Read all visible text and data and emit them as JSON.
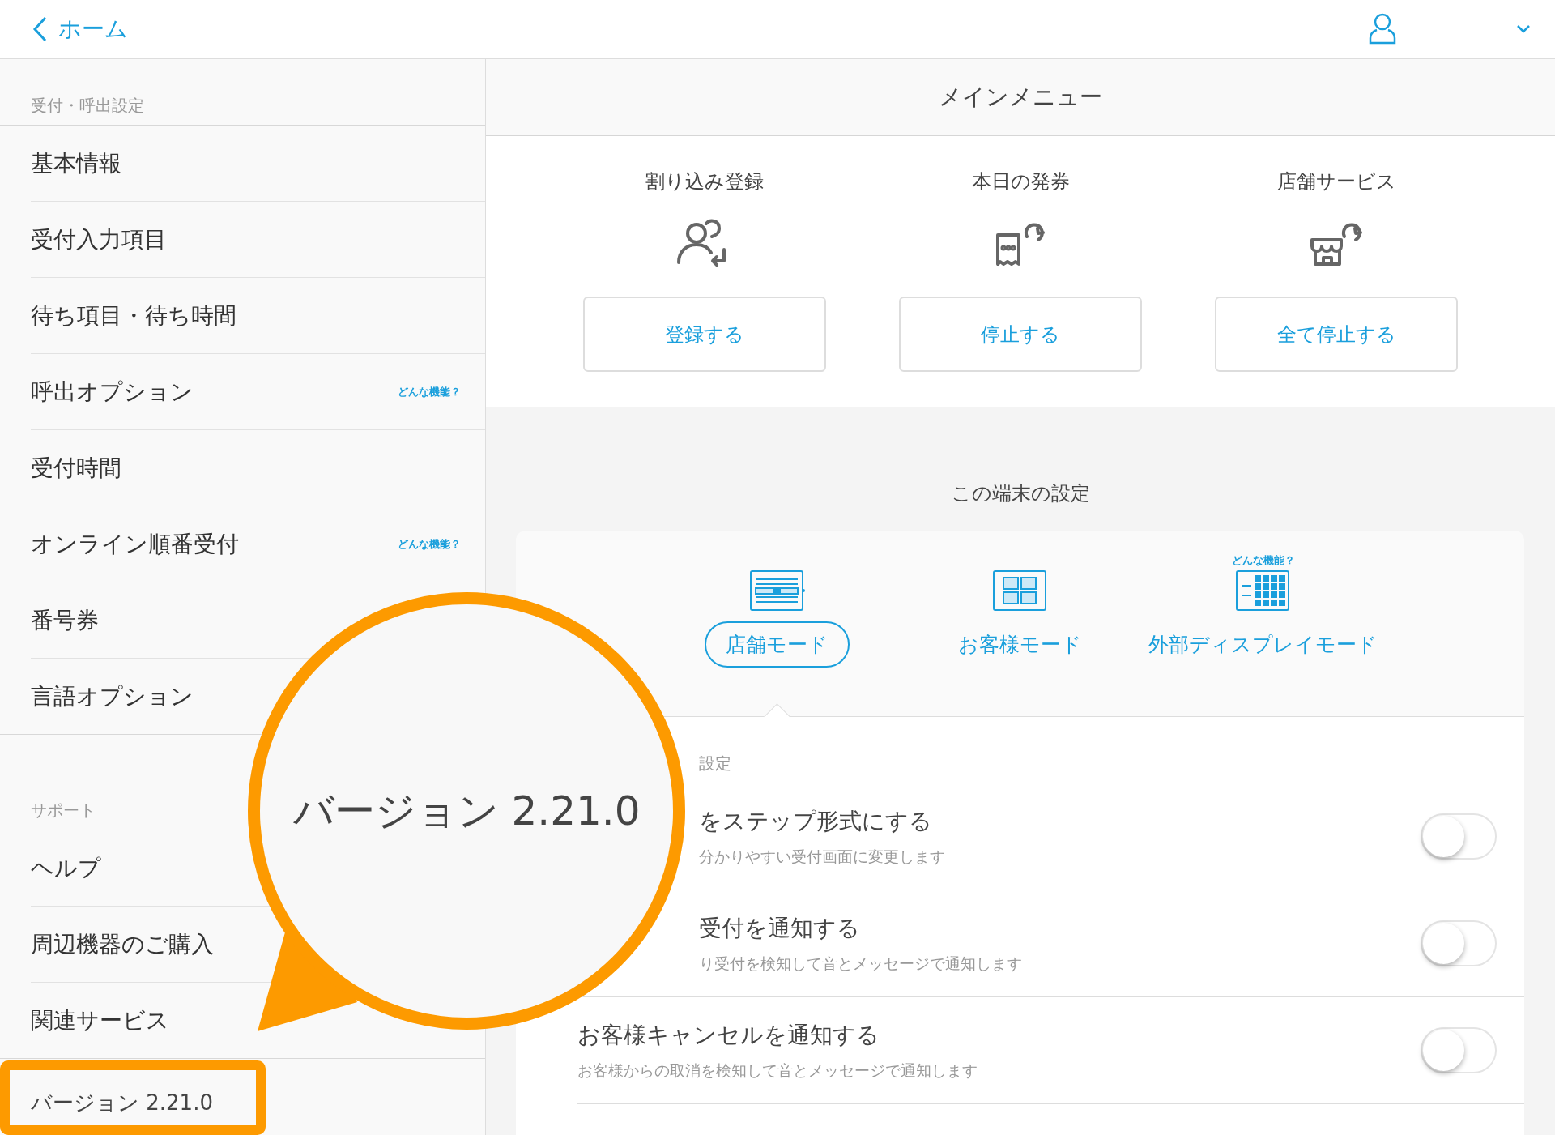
{
  "top_bar": {
    "back_label": "ホーム"
  },
  "sidebar": {
    "sections": [
      {
        "title": "受付・呼出設定",
        "items": [
          {
            "label": "基本情報"
          },
          {
            "label": "受付入力項目"
          },
          {
            "label": "待ち項目・待ち時間"
          },
          {
            "label": "呼出オプション",
            "help": "どんな機能？"
          },
          {
            "label": "受付時間"
          },
          {
            "label": "オンライン順番受付",
            "help": "どんな機能？"
          },
          {
            "label": "番号券"
          },
          {
            "label": "言語オプション"
          }
        ]
      },
      {
        "title": "サポート",
        "items": [
          {
            "label": "ヘルプ"
          },
          {
            "label": "周辺機器のご購入"
          },
          {
            "label": "関連サービス"
          }
        ]
      }
    ],
    "version": {
      "label": "バージョン 2.21.0",
      "highlighted": true
    }
  },
  "main_menu": {
    "title": "メインメニュー",
    "actions": [
      {
        "title": "割り込み登録",
        "kind": "people",
        "button": "登録する"
      },
      {
        "title": "本日の発券",
        "kind": "ticket",
        "button": "停止する"
      },
      {
        "title": "店舗サービス",
        "kind": "store",
        "button": "全て停止する"
      }
    ]
  },
  "device_settings": {
    "title": "この端末の設定",
    "modes": [
      {
        "label": "店舗モード",
        "kind": "store",
        "selected": true
      },
      {
        "label": "お客様モード",
        "kind": "customer",
        "selected": false
      },
      {
        "label": "外部ディスプレイモード",
        "kind": "display",
        "selected": false,
        "help": "どんな機能？"
      }
    ],
    "section_label": "設定",
    "rows": [
      {
        "title": "をステップ形式にする",
        "description": "分かりやすい受付画面に変更します",
        "on": false,
        "cut": true
      },
      {
        "title": "受付を通知する",
        "description": "り受付を検知して音とメッセージで通知します",
        "on": false,
        "cut": true
      },
      {
        "title": "お客様キャンセルを通知する",
        "description": "お客様からの取消を検知して音とメッセージで通知します",
        "on": false
      }
    ]
  },
  "callout": {
    "text": "バージョン 2.21.0"
  }
}
